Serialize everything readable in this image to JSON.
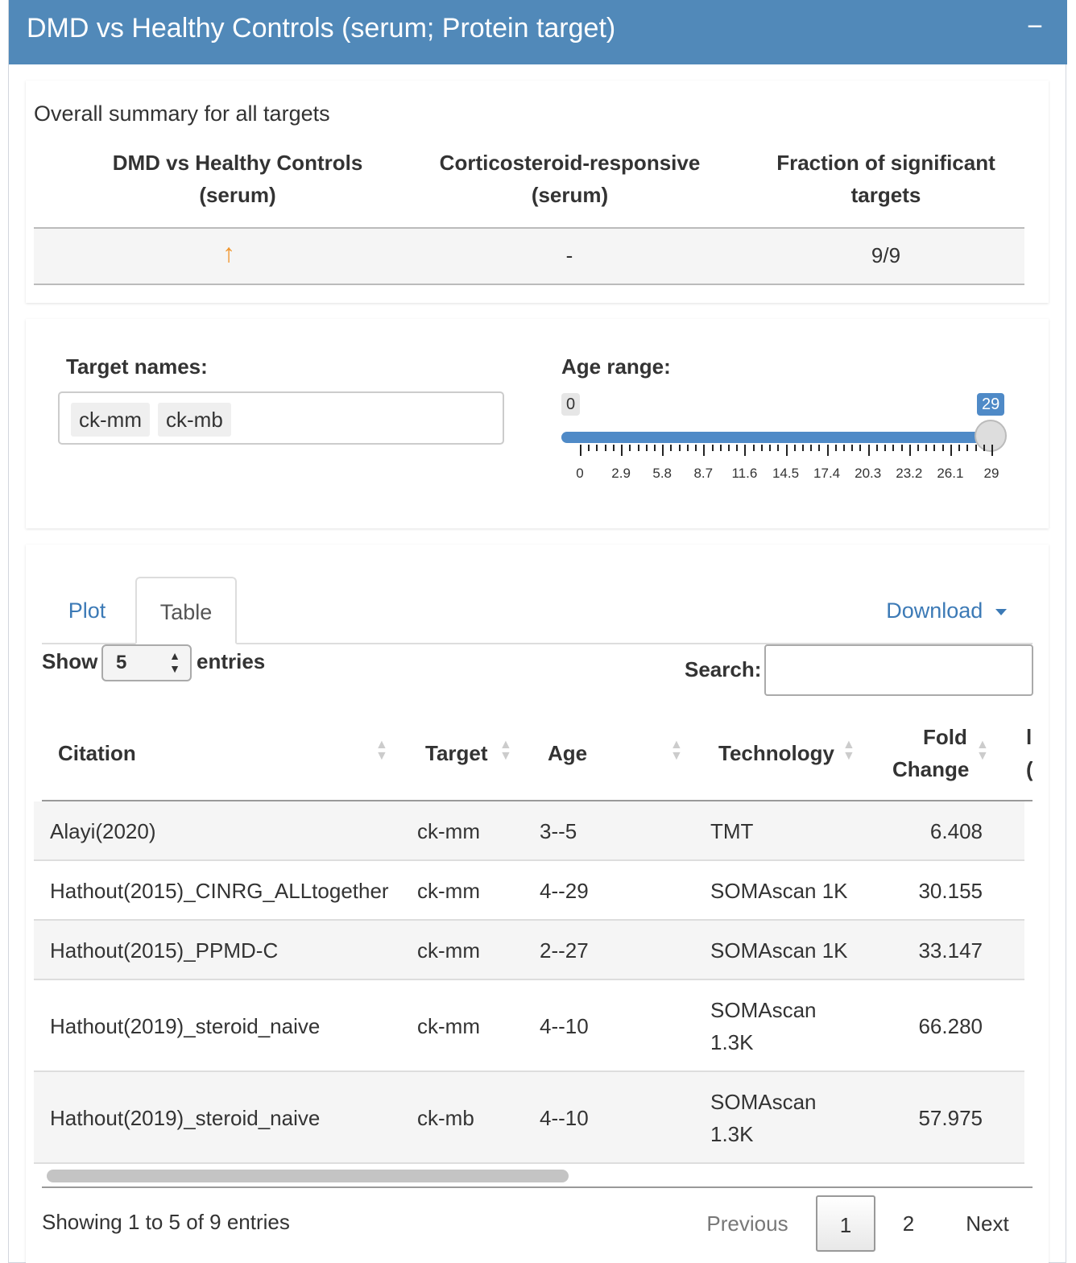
{
  "panel": {
    "title": "DMD vs Healthy Controls (serum; Protein target)",
    "collapse_glyph": "−"
  },
  "summary": {
    "label": "Overall summary for all targets",
    "headers": [
      "DMD vs Healthy Controls (serum)",
      "Corticosteroid-responsive (serum)",
      "Fraction of significant targets"
    ],
    "row": {
      "dmd_icon": "arrow-up-icon",
      "dmd_glyph": "↑",
      "cortico": "-",
      "fraction": "9/9"
    },
    "arrow_color": "#f0962e"
  },
  "filters": {
    "target_label": "Target names:",
    "target_tags": [
      "ck-mm",
      "ck-mb"
    ],
    "age_label": "Age range:",
    "age_min": "0",
    "age_max": "29",
    "age_ticks": [
      "0",
      "2.9",
      "5.8",
      "8.7",
      "11.6",
      "14.5",
      "17.4",
      "20.3",
      "23.2",
      "26.1",
      "29"
    ]
  },
  "tabs": {
    "plot": "Plot",
    "table": "Table",
    "download": "Download"
  },
  "table": {
    "show_label": "Show",
    "page_size": "5",
    "entries_label": "entries",
    "search_label": "Search:",
    "search_value": "",
    "columns": {
      "citation": "Citation",
      "target": "Target",
      "age": "Age",
      "technology": "Technology",
      "fold_change_1": "Fold",
      "fold_change_2": "Change",
      "next_col_1": "l",
      "next_col_2": "("
    },
    "rows": [
      {
        "citation": "Alayi(2020)",
        "target": "ck-mm",
        "age": "3--5",
        "tech_1": "TMT",
        "tech_2": "",
        "fold": "6.408"
      },
      {
        "citation": "Hathout(2015)_CINRG_ALLtogether",
        "target": "ck-mm",
        "age": "4--29",
        "tech_1": "SOMAscan 1K",
        "tech_2": "",
        "fold": "30.155"
      },
      {
        "citation": "Hathout(2015)_PPMD-C",
        "target": "ck-mm",
        "age": "2--27",
        "tech_1": "SOMAscan 1K",
        "tech_2": "",
        "fold": "33.147"
      },
      {
        "citation": "Hathout(2019)_steroid_naive",
        "target": "ck-mm",
        "age": "4--10",
        "tech_1": "SOMAscan",
        "tech_2": "1.3K",
        "fold": "66.280"
      },
      {
        "citation": "Hathout(2019)_steroid_naive",
        "target": "ck-mb",
        "age": "4--10",
        "tech_1": "SOMAscan",
        "tech_2": "1.3K",
        "fold": "57.975"
      }
    ],
    "info": "Showing 1 to 5 of 9 entries",
    "pagination": {
      "previous": "Previous",
      "page1": "1",
      "page2": "2",
      "next": "Next"
    }
  },
  "colors": {
    "header": "#5189b9",
    "link": "#3c7ab6",
    "slider": "#4f8ac7"
  }
}
